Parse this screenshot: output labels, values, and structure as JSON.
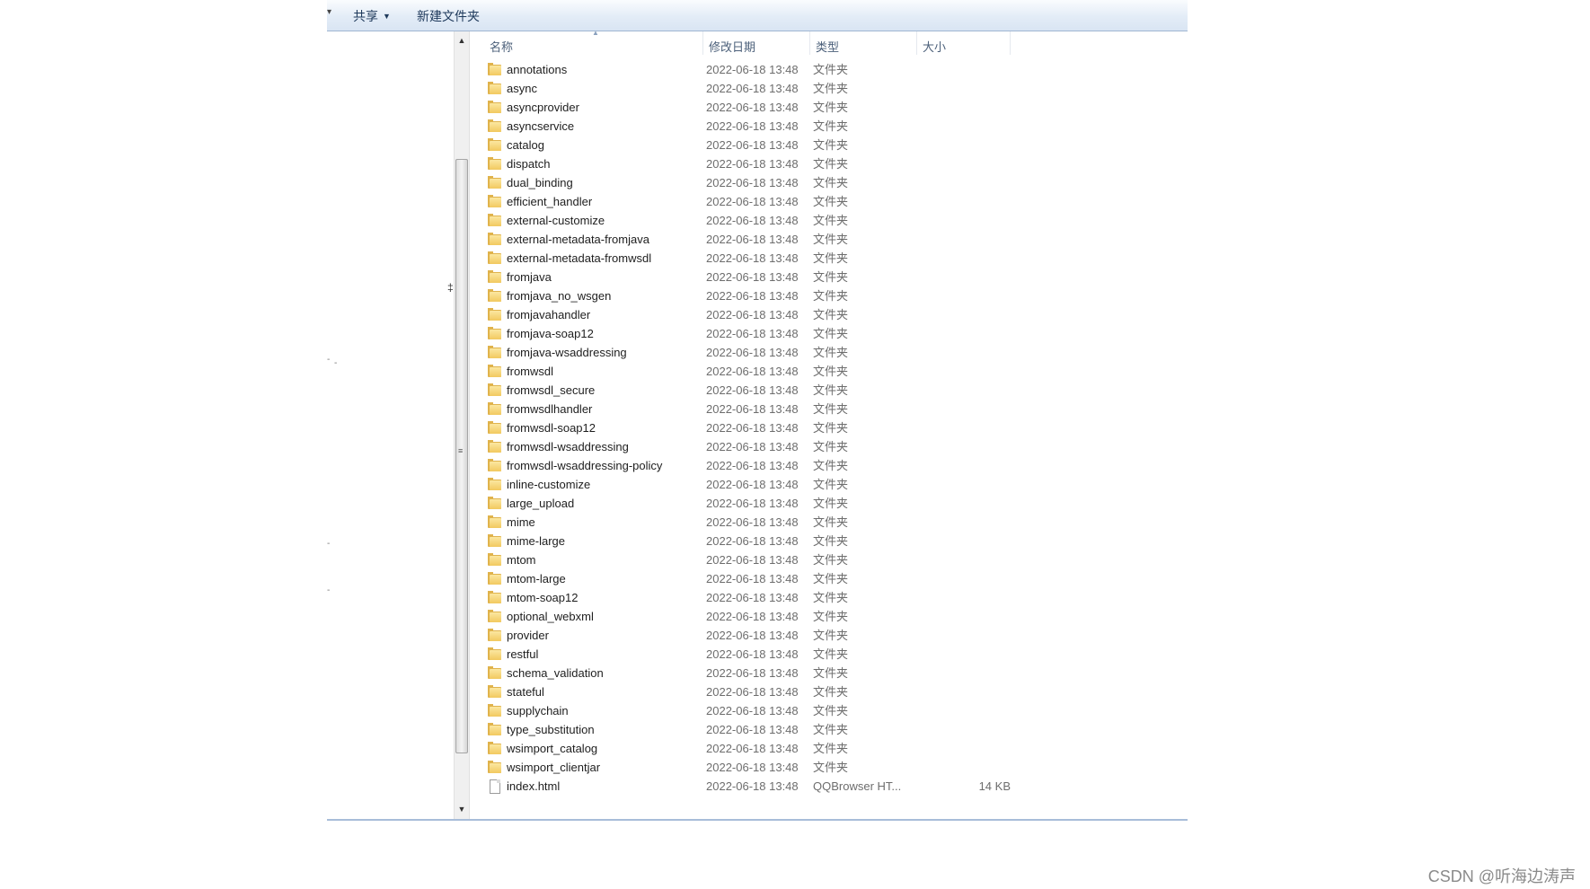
{
  "toolbar": {
    "share_label": "共享",
    "share_caret": "▼",
    "new_folder_label": "新建文件夹"
  },
  "columns": {
    "name": "名称",
    "modified": "修改日期",
    "type": "类型",
    "size": "大小"
  },
  "icons": {
    "folder": "folder-icon",
    "file": "file-icon",
    "scroll_up": "▲",
    "scroll_down": "▼"
  },
  "files": [
    {
      "name": "annotations",
      "modified": "2022-06-18 13:48",
      "type": "文件夹",
      "size": "",
      "kind": "folder"
    },
    {
      "name": "async",
      "modified": "2022-06-18 13:48",
      "type": "文件夹",
      "size": "",
      "kind": "folder"
    },
    {
      "name": "asyncprovider",
      "modified": "2022-06-18 13:48",
      "type": "文件夹",
      "size": "",
      "kind": "folder"
    },
    {
      "name": "asyncservice",
      "modified": "2022-06-18 13:48",
      "type": "文件夹",
      "size": "",
      "kind": "folder"
    },
    {
      "name": "catalog",
      "modified": "2022-06-18 13:48",
      "type": "文件夹",
      "size": "",
      "kind": "folder"
    },
    {
      "name": "dispatch",
      "modified": "2022-06-18 13:48",
      "type": "文件夹",
      "size": "",
      "kind": "folder"
    },
    {
      "name": "dual_binding",
      "modified": "2022-06-18 13:48",
      "type": "文件夹",
      "size": "",
      "kind": "folder"
    },
    {
      "name": "efficient_handler",
      "modified": "2022-06-18 13:48",
      "type": "文件夹",
      "size": "",
      "kind": "folder"
    },
    {
      "name": "external-customize",
      "modified": "2022-06-18 13:48",
      "type": "文件夹",
      "size": "",
      "kind": "folder"
    },
    {
      "name": "external-metadata-fromjava",
      "modified": "2022-06-18 13:48",
      "type": "文件夹",
      "size": "",
      "kind": "folder"
    },
    {
      "name": "external-metadata-fromwsdl",
      "modified": "2022-06-18 13:48",
      "type": "文件夹",
      "size": "",
      "kind": "folder"
    },
    {
      "name": "fromjava",
      "modified": "2022-06-18 13:48",
      "type": "文件夹",
      "size": "",
      "kind": "folder"
    },
    {
      "name": "fromjava_no_wsgen",
      "modified": "2022-06-18 13:48",
      "type": "文件夹",
      "size": "",
      "kind": "folder"
    },
    {
      "name": "fromjavahandler",
      "modified": "2022-06-18 13:48",
      "type": "文件夹",
      "size": "",
      "kind": "folder"
    },
    {
      "name": "fromjava-soap12",
      "modified": "2022-06-18 13:48",
      "type": "文件夹",
      "size": "",
      "kind": "folder"
    },
    {
      "name": "fromjava-wsaddressing",
      "modified": "2022-06-18 13:48",
      "type": "文件夹",
      "size": "",
      "kind": "folder"
    },
    {
      "name": "fromwsdl",
      "modified": "2022-06-18 13:48",
      "type": "文件夹",
      "size": "",
      "kind": "folder"
    },
    {
      "name": "fromwsdl_secure",
      "modified": "2022-06-18 13:48",
      "type": "文件夹",
      "size": "",
      "kind": "folder"
    },
    {
      "name": "fromwsdlhandler",
      "modified": "2022-06-18 13:48",
      "type": "文件夹",
      "size": "",
      "kind": "folder"
    },
    {
      "name": "fromwsdl-soap12",
      "modified": "2022-06-18 13:48",
      "type": "文件夹",
      "size": "",
      "kind": "folder"
    },
    {
      "name": "fromwsdl-wsaddressing",
      "modified": "2022-06-18 13:48",
      "type": "文件夹",
      "size": "",
      "kind": "folder"
    },
    {
      "name": "fromwsdl-wsaddressing-policy",
      "modified": "2022-06-18 13:48",
      "type": "文件夹",
      "size": "",
      "kind": "folder"
    },
    {
      "name": "inline-customize",
      "modified": "2022-06-18 13:48",
      "type": "文件夹",
      "size": "",
      "kind": "folder"
    },
    {
      "name": "large_upload",
      "modified": "2022-06-18 13:48",
      "type": "文件夹",
      "size": "",
      "kind": "folder"
    },
    {
      "name": "mime",
      "modified": "2022-06-18 13:48",
      "type": "文件夹",
      "size": "",
      "kind": "folder"
    },
    {
      "name": "mime-large",
      "modified": "2022-06-18 13:48",
      "type": "文件夹",
      "size": "",
      "kind": "folder"
    },
    {
      "name": "mtom",
      "modified": "2022-06-18 13:48",
      "type": "文件夹",
      "size": "",
      "kind": "folder"
    },
    {
      "name": "mtom-large",
      "modified": "2022-06-18 13:48",
      "type": "文件夹",
      "size": "",
      "kind": "folder"
    },
    {
      "name": "mtom-soap12",
      "modified": "2022-06-18 13:48",
      "type": "文件夹",
      "size": "",
      "kind": "folder"
    },
    {
      "name": "optional_webxml",
      "modified": "2022-06-18 13:48",
      "type": "文件夹",
      "size": "",
      "kind": "folder"
    },
    {
      "name": "provider",
      "modified": "2022-06-18 13:48",
      "type": "文件夹",
      "size": "",
      "kind": "folder"
    },
    {
      "name": "restful",
      "modified": "2022-06-18 13:48",
      "type": "文件夹",
      "size": "",
      "kind": "folder"
    },
    {
      "name": "schema_validation",
      "modified": "2022-06-18 13:48",
      "type": "文件夹",
      "size": "",
      "kind": "folder"
    },
    {
      "name": "stateful",
      "modified": "2022-06-18 13:48",
      "type": "文件夹",
      "size": "",
      "kind": "folder"
    },
    {
      "name": "supplychain",
      "modified": "2022-06-18 13:48",
      "type": "文件夹",
      "size": "",
      "kind": "folder"
    },
    {
      "name": "type_substitution",
      "modified": "2022-06-18 13:48",
      "type": "文件夹",
      "size": "",
      "kind": "folder"
    },
    {
      "name": "wsimport_catalog",
      "modified": "2022-06-18 13:48",
      "type": "文件夹",
      "size": "",
      "kind": "folder"
    },
    {
      "name": "wsimport_clientjar",
      "modified": "2022-06-18 13:48",
      "type": "文件夹",
      "size": "",
      "kind": "folder"
    },
    {
      "name": "index.html",
      "modified": "2022-06-18 13:48",
      "type": "QQBrowser HT...",
      "size": "14 KB",
      "kind": "file"
    }
  ],
  "watermark": "CSDN @听海边涛声",
  "colors": {
    "toolbar_text": "#1e395b",
    "folder": "#f2c95f",
    "border": "#a8bdd9"
  }
}
